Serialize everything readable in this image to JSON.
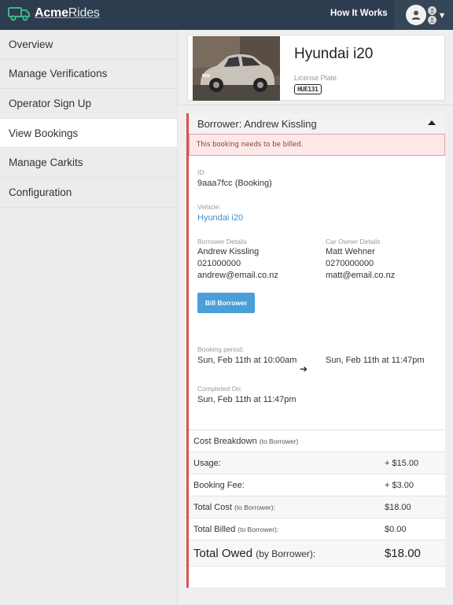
{
  "app": {
    "brand_prefix": "Acme",
    "brand_suffix": "Rides",
    "nav_link": "How It Works"
  },
  "sidebar": {
    "items": [
      {
        "label": "Overview"
      },
      {
        "label": "Manage Verifications"
      },
      {
        "label": "Operator Sign Up"
      },
      {
        "label": "View Bookings"
      },
      {
        "label": "Manage Carkits"
      },
      {
        "label": "Configuration"
      }
    ],
    "active_index": 3
  },
  "vehicle": {
    "title": "Hyundai i20",
    "plate_label": "License Plate",
    "plate": "HUE131"
  },
  "booking": {
    "header": "Borrower: Andrew Kissling",
    "alert": "This booking needs to be billed.",
    "id_label": "ID:",
    "id_value": "9aaa7fcc (Booking)",
    "vehicle_label": "Vehicle:",
    "vehicle_value": "Hyundai i20",
    "borrower_label": "Borrower Details",
    "borrower_name": "Andrew Kissling",
    "borrower_phone": "021000000",
    "borrower_email": "andrew@email.co.nz",
    "owner_label": "Car Owner Details",
    "owner_name": "Matt Wehner",
    "owner_phone": "0270000000",
    "owner_email": "matt@email.co.nz",
    "bill_button": "Bill Borrower",
    "period_label": "Booking period:",
    "period_start": "Sun, Feb 11th at 10:00am",
    "period_end": "Sun, Feb 11th at 11:47pm",
    "completed_label": "Completed On:",
    "completed_value": "Sun, Feb 11th at 11:47pm"
  },
  "costs": {
    "breakdown_label": "Cost Breakdown",
    "breakdown_note": "(to Borrower)",
    "usage_label": "Usage:",
    "usage_value": "+ $15.00",
    "fee_label": "Booking Fee:",
    "fee_value": "+ $3.00",
    "total_cost_label": "Total Cost",
    "total_cost_note": "(to Borrower):",
    "total_cost_value": "$18.00",
    "total_billed_label": "Total Billed",
    "total_billed_note": "(to Borrower):",
    "total_billed_value": "$0.00",
    "total_owed_label": "Total Owed",
    "total_owed_note": "(by Borrower):",
    "total_owed_value": "$18.00"
  },
  "colors": {
    "topbar": "#2d3d4f",
    "accent_blue": "#4a9fd9",
    "alert_red": "#d9534f",
    "brand_green": "#3bb88a"
  },
  "icons": {
    "brand": "truck-icon",
    "user": "user-avatar-icon",
    "menu_caret": "caret-down-icon",
    "collapse": "caret-up-icon",
    "arrow": "arrow-right-icon"
  }
}
